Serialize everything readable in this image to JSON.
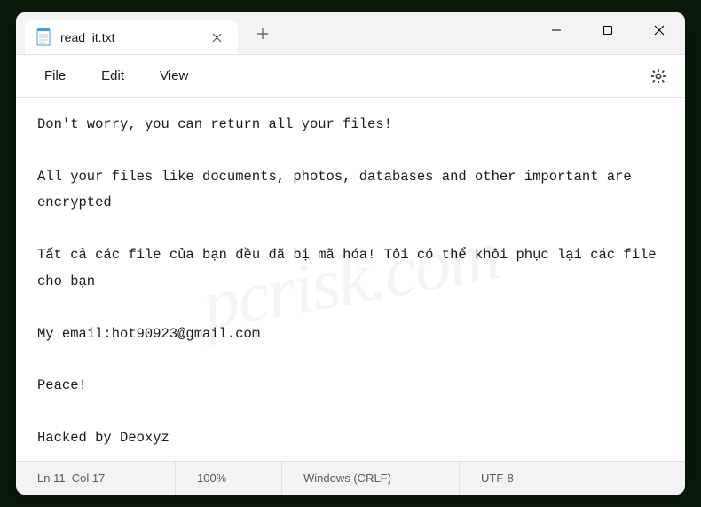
{
  "tab": {
    "title": "read_it.txt"
  },
  "menu": {
    "file": "File",
    "edit": "Edit",
    "view": "View"
  },
  "content": {
    "text": "Don't worry, you can return all your files!\n\nAll your files like documents, photos, databases and other important are encrypted\n\nTất cả các file của bạn đều đã bị mã hóa! Tôi có thể khôi phục lại các file cho bạn\n\nMy email:hot90923@gmail.com\n\nPeace!\n\nHacked by Deoxyz"
  },
  "status": {
    "position": "Ln 11, Col 17",
    "zoom": "100%",
    "line_ending": "Windows (CRLF)",
    "encoding": "UTF-8"
  },
  "watermark": "pcrisk.com"
}
